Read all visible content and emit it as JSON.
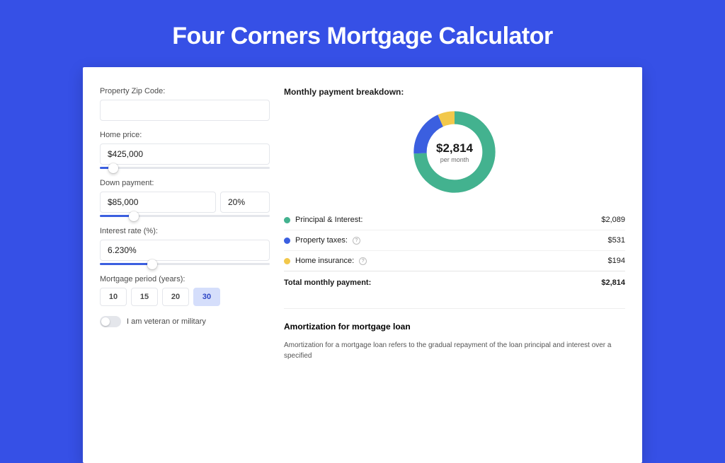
{
  "title": "Four Corners Mortgage Calculator",
  "form": {
    "zip_label": "Property Zip Code:",
    "zip_value": "",
    "price_label": "Home price:",
    "price_value": "$425,000",
    "price_fill_pct": 8,
    "dp_label": "Down payment:",
    "dp_value": "$85,000",
    "dp_pct_value": "20%",
    "dp_fill_pct": 20,
    "rate_label": "Interest rate (%):",
    "rate_value": "6.230%",
    "rate_fill_pct": 31,
    "period_label": "Mortgage period (years):",
    "periods": [
      "10",
      "15",
      "20",
      "30"
    ],
    "period_active": "30",
    "vet_label": "I am veteran or military"
  },
  "breakdown": {
    "title": "Monthly payment breakdown:",
    "center_amount": "$2,814",
    "center_sub": "per month",
    "items": [
      {
        "label": "Principal & Interest:",
        "value": "$2,089",
        "color": "#43B28F",
        "has_help": false
      },
      {
        "label": "Property taxes:",
        "value": "$531",
        "color": "#3B5FE0",
        "has_help": true
      },
      {
        "label": "Home insurance:",
        "value": "$194",
        "color": "#F2C84B",
        "has_help": true
      }
    ],
    "total_label": "Total monthly payment:",
    "total_value": "$2,814"
  },
  "chart_data": {
    "type": "pie",
    "title": "Monthly payment breakdown",
    "series": [
      {
        "name": "Principal & Interest",
        "value": 2089,
        "color": "#43B28F"
      },
      {
        "name": "Property taxes",
        "value": 531,
        "color": "#3B5FE0"
      },
      {
        "name": "Home insurance",
        "value": 194,
        "color": "#F2C84B"
      }
    ],
    "total": 2814,
    "unit": "USD/month"
  },
  "amort": {
    "heading": "Amortization for mortgage loan",
    "body": "Amortization for a mortgage loan refers to the gradual repayment of the loan principal and interest over a specified"
  }
}
